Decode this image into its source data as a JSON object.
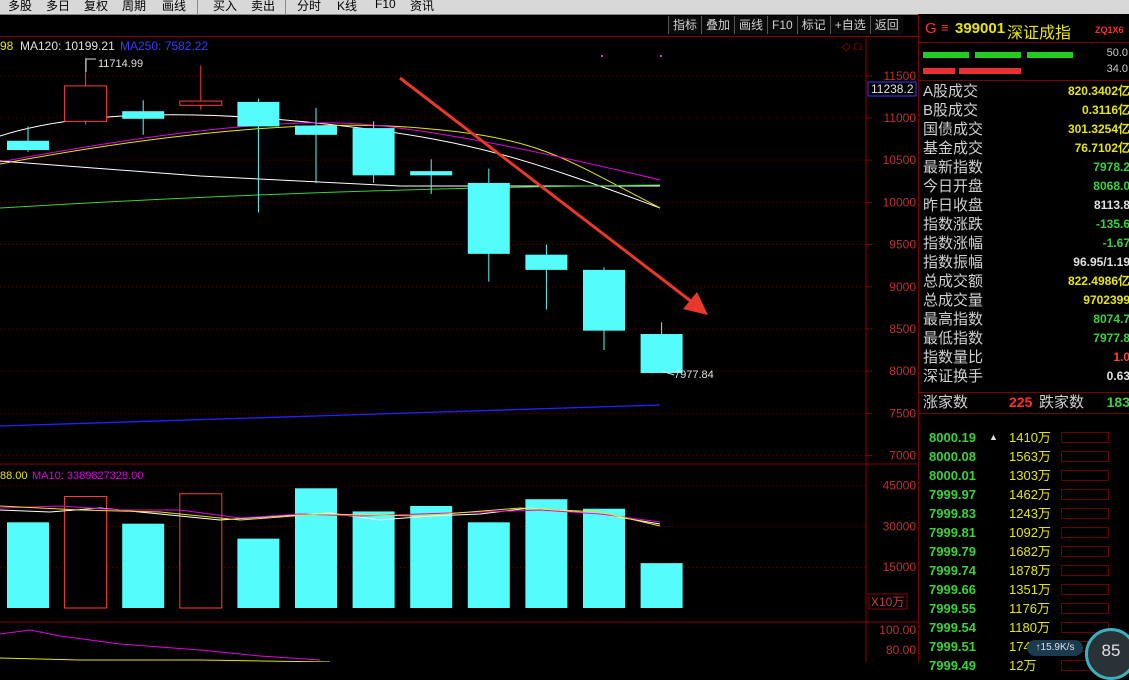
{
  "toolbar": [
    "多股",
    "多日",
    "复权",
    "周期",
    "画线",
    "买入",
    "卖出",
    "分时",
    "K线",
    "F10",
    "资讯"
  ],
  "tabs": [
    "指标",
    "叠加",
    "画线",
    "F10",
    "标记",
    "+自选",
    "返回"
  ],
  "kline": {
    "legend": {
      "prefix": "98",
      "ma120_label": "MA120: 10199.21",
      "ma250_label": "MA250: 7582.22"
    },
    "high_label": "11714.99",
    "low_label": "7977.84",
    "price_tag": "11238.2",
    "y_ticks": [
      "11500",
      "11000",
      "10500",
      "10000",
      "9500",
      "9000",
      "8500",
      "8000",
      "7500",
      "7000"
    ],
    "y_range": [
      6900,
      11900
    ],
    "candles": [
      {
        "o": 10730,
        "c": 10620,
        "h": 10900,
        "l": 10600
      },
      {
        "o": 10960,
        "c": 11380,
        "h": 11714.99,
        "l": 10920
      },
      {
        "o": 11080,
        "c": 10990,
        "h": 11210,
        "l": 10800
      },
      {
        "o": 11150,
        "c": 11200,
        "h": 11620,
        "l": 11100
      },
      {
        "o": 11190,
        "c": 10900,
        "h": 11230,
        "l": 9880
      },
      {
        "o": 10910,
        "c": 10800,
        "h": 11120,
        "l": 10230
      },
      {
        "o": 10880,
        "c": 10320,
        "h": 10960,
        "l": 10230
      },
      {
        "o": 10370,
        "c": 10320,
        "h": 10510,
        "l": 10100
      },
      {
        "o": 10230,
        "c": 9390,
        "h": 10400,
        "l": 9060
      },
      {
        "o": 9380,
        "c": 9200,
        "h": 9500,
        "l": 8730
      },
      {
        "o": 9200,
        "c": 8480,
        "h": 9230,
        "l": 8250
      },
      {
        "o": 8440,
        "c": 7977.84,
        "h": 8580,
        "l": 7977.84
      }
    ]
  },
  "volume": {
    "legend": {
      "prefix": "88.00",
      "ma10_label": "MA10: 3389827328.00"
    },
    "y_ticks": [
      "45000",
      "30000",
      "15000"
    ],
    "unit_label": "X10万",
    "bars": [
      31500,
      41000,
      31000,
      42000,
      25500,
      44000,
      35500,
      37500,
      31500,
      40000,
      36500,
      16500
    ]
  },
  "indicator": {
    "y_ticks": [
      "100.00",
      "80.00"
    ]
  },
  "panel": {
    "g": "G",
    "menu": "≡",
    "code": "399001",
    "name": "深证成指",
    "badge": "ZQ1X6",
    "bar1_val": "50.0",
    "bar2_val": "34.0",
    "stats": [
      {
        "label": "A股成交",
        "value": "820.3402亿",
        "color": "#e6e600"
      },
      {
        "label": "B股成交",
        "value": "0.3116亿",
        "color": "#e6e600"
      },
      {
        "label": "国债成交",
        "value": "301.3254亿",
        "color": "#e6e600"
      },
      {
        "label": "基金成交",
        "value": "76.7102亿",
        "color": "#e6e600"
      },
      {
        "label": "最新指数",
        "value": "7978.2",
        "color": "#39d239"
      },
      {
        "label": "今日开盘",
        "value": "8068.0",
        "color": "#39d239"
      },
      {
        "label": "昨日收盘",
        "value": "8113.8",
        "color": "#e0e0e0"
      },
      {
        "label": "指数涨跌",
        "value": "-135.6",
        "color": "#39d239"
      },
      {
        "label": "指数涨幅",
        "value": "-1.67",
        "color": "#39d239"
      },
      {
        "label": "指数振幅",
        "value": "96.95/1.19",
        "color": "#e0e0e0"
      },
      {
        "label": "总成交额",
        "value": "822.4986亿",
        "color": "#e6e600"
      },
      {
        "label": "总成交量",
        "value": "9702399",
        "color": "#e6e600"
      },
      {
        "label": "最高指数",
        "value": "8074.7",
        "color": "#39d239"
      },
      {
        "label": "最低指数",
        "value": "7977.8",
        "color": "#39d239"
      },
      {
        "label": "指数量比",
        "value": "1.0",
        "color": "#ff4040"
      },
      {
        "label": "深证换手",
        "value": "0.63",
        "color": "#e0e0e0"
      }
    ],
    "up_label": "涨家数",
    "up_count": "225",
    "down_label": "跌家数",
    "down_count": "183",
    "ticks": [
      {
        "p": "8000.19",
        "v": "1410万"
      },
      {
        "p": "8000.08",
        "v": "1563万"
      },
      {
        "p": "8000.01",
        "v": "1303万"
      },
      {
        "p": "7999.97",
        "v": "1462万"
      },
      {
        "p": "7999.83",
        "v": "1243万"
      },
      {
        "p": "7999.81",
        "v": "1092万"
      },
      {
        "p": "7999.79",
        "v": "1682万"
      },
      {
        "p": "7999.74",
        "v": "1878万"
      },
      {
        "p": "7999.66",
        "v": "1351万"
      },
      {
        "p": "7999.55",
        "v": "1176万"
      },
      {
        "p": "7999.54",
        "v": "1180万"
      },
      {
        "p": "7999.51",
        "v": "1743万"
      },
      {
        "p": "7999.49",
        "v": "12万"
      }
    ],
    "speed": "15.9",
    "speed_unit": "K/s",
    "gauge": "85"
  }
}
